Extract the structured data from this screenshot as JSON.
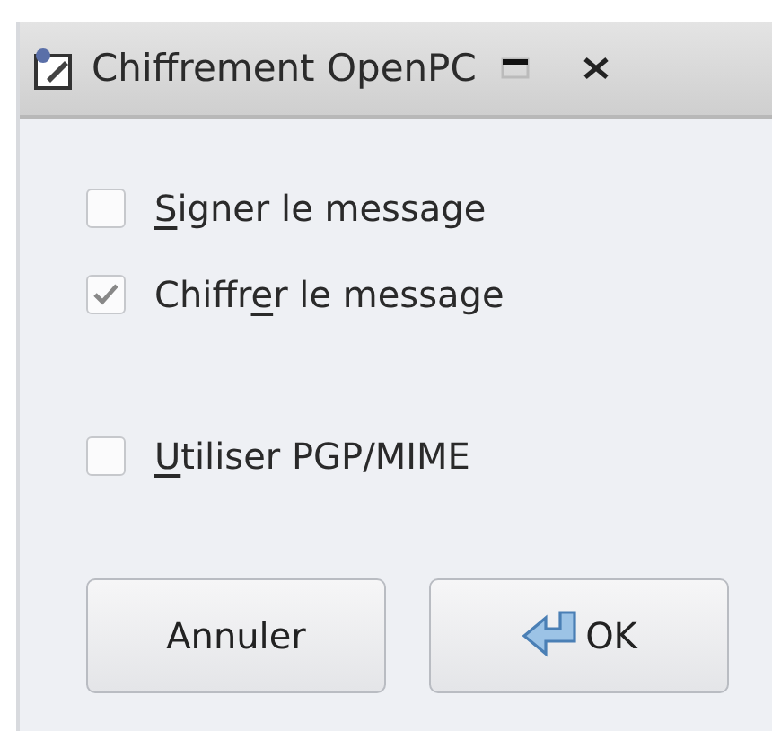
{
  "window": {
    "title": "Chiffrement OpenPC"
  },
  "options": [
    {
      "label_parts": [
        {
          "text": "S",
          "underlined": true
        },
        {
          "text": "igner le message",
          "underlined": false
        }
      ],
      "checked": false
    },
    {
      "label_parts": [
        {
          "text": "Chiffr",
          "underlined": false
        },
        {
          "text": "e",
          "underlined": true
        },
        {
          "text": "r le message",
          "underlined": false
        }
      ],
      "checked": true
    },
    {
      "label_parts": [
        {
          "text": "U",
          "underlined": true
        },
        {
          "text": "tiliser PGP/MIME",
          "underlined": false
        }
      ],
      "checked": false
    }
  ],
  "buttons": [
    {
      "label": "Annuler",
      "kind": "plain"
    },
    {
      "label": "OK",
      "kind": "enter"
    }
  ]
}
